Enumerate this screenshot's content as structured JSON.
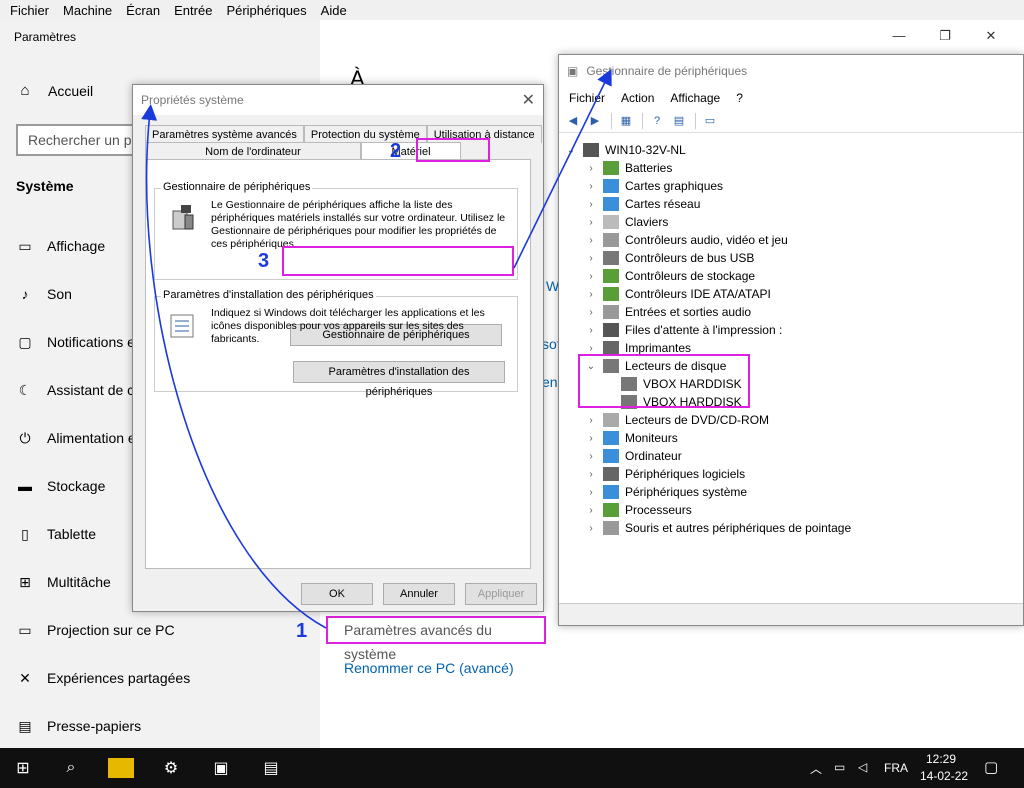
{
  "vm_menu": [
    "Fichier",
    "Machine",
    "Écran",
    "Entrée",
    "Périphériques",
    "Aide"
  ],
  "settings": {
    "title": "Paramètres",
    "home": "Accueil",
    "search_placeholder": "Rechercher un pa",
    "section": "Système",
    "items": [
      {
        "label": "Affichage",
        "icon": "monitor-icon"
      },
      {
        "label": "Son",
        "icon": "speaker-icon"
      },
      {
        "label": "Notifications e",
        "icon": "notification-icon"
      },
      {
        "label": "Assistant de c",
        "icon": "moon-icon"
      },
      {
        "label": "Alimentation e",
        "icon": "power-icon"
      },
      {
        "label": "Stockage",
        "icon": "storage-icon"
      },
      {
        "label": "Tablette",
        "icon": "tablet-icon"
      },
      {
        "label": "Multitâche",
        "icon": "multitask-icon"
      },
      {
        "label": "Projection sur ce PC",
        "icon": "projection-icon"
      },
      {
        "label": "Expériences partagées",
        "icon": "share-icon"
      },
      {
        "label": "Presse-papiers",
        "icon": "clipboard-icon"
      }
    ],
    "link_advanced": "Paramètres avancés du système",
    "link_rename": "Renommer ce PC (avancé)"
  },
  "props": {
    "title": "Propriétés système",
    "tabs_row1": [
      "Paramètres système avancés",
      "Protection du système",
      "Utilisation à distance"
    ],
    "tabs_row2": [
      "Nom de l'ordinateur",
      "Matériel"
    ],
    "group1_title": "Gestionnaire de périphériques",
    "group1_text": "Le Gestionnaire de périphériques affiche la liste des périphériques matériels installés sur votre ordinateur. Utilisez le Gestionnaire de périphériques pour modifier les propriétés de ces périphériques.",
    "group1_button": "Gestionnaire de périphériques",
    "group2_title": "Paramètres d'installation des périphériques",
    "group2_text": "Indiquez si Windows doit télécharger les applications et les icônes disponibles pour vos appareils sur les sites des fabricants.",
    "group2_button": "Paramètres d'installation des périphériques",
    "ok": "OK",
    "cancel": "Annuler",
    "apply": "Appliquer"
  },
  "devmgr": {
    "title": "Gestionnaire de périphériques",
    "menu": [
      "Fichier",
      "Action",
      "Affichage",
      "?"
    ],
    "root": "WIN10-32V-NL",
    "nodes": [
      "Batteries",
      "Cartes graphiques",
      "Cartes réseau",
      "Claviers",
      "Contrôleurs audio, vidéo et jeu",
      "Contrôleurs de bus USB",
      "Contrôleurs de stockage",
      "Contrôleurs IDE ATA/ATAPI",
      "Entrées et sorties audio",
      "Files d'attente à l'impression :",
      "Imprimantes",
      "Lecteurs de disque",
      "VBOX HARDDISK",
      "VBOX HARDDISK",
      "Lecteurs de DVD/CD-ROM",
      "Moniteurs",
      "Ordinateur",
      "Périphériques logiciels",
      "Périphériques système",
      "Processeurs",
      "Souris et autres périphériques de pointage"
    ]
  },
  "annotations": [
    "1",
    "2",
    "3"
  ],
  "taskbar": {
    "lang": "FRA",
    "time": "12:29",
    "date": "14-02-22"
  },
  "colors": {
    "highlight": "#e020e0",
    "annotation": "#1a3adc",
    "link": "#0063b1"
  }
}
